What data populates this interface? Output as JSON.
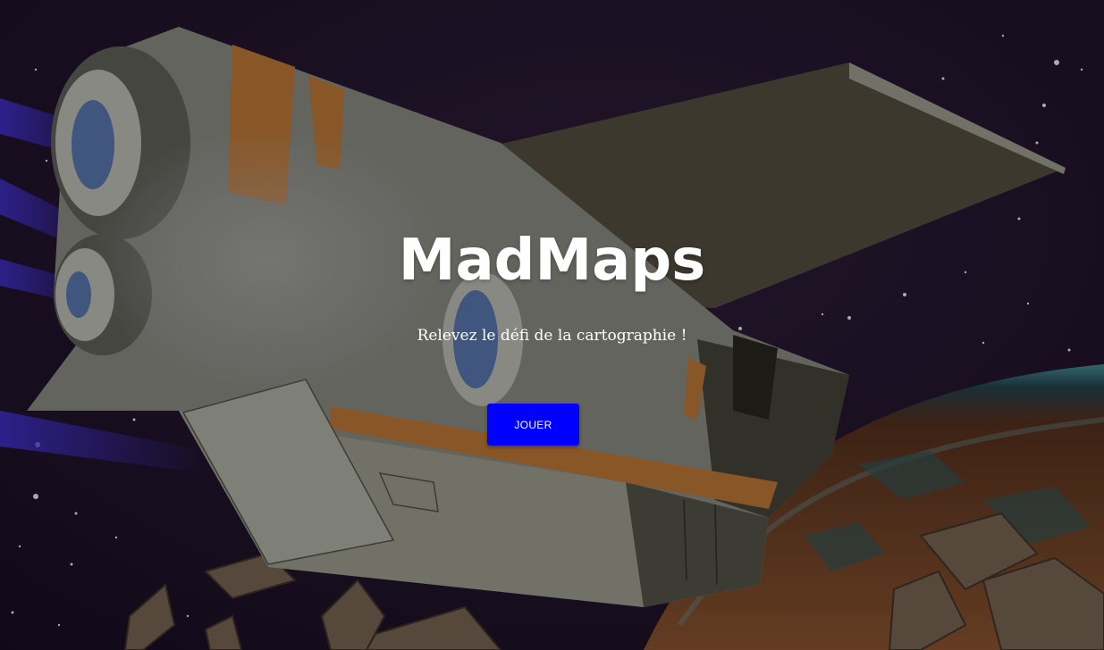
{
  "hero": {
    "title": "MadMaps",
    "subtitle": "Relevez le défi de la cartographie !",
    "play_label": "JOUER"
  },
  "colors": {
    "button_bg": "#0000ff",
    "text": "#ffffff",
    "space_bg": "#1b1024"
  }
}
